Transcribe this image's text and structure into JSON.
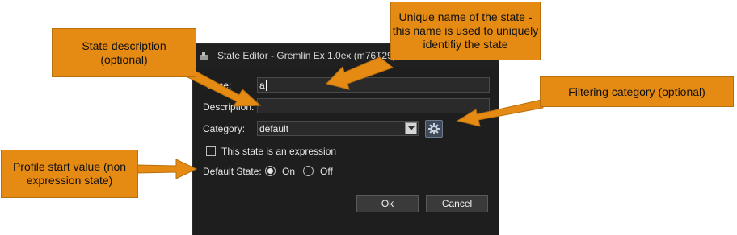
{
  "dialog": {
    "title": "State Editor - Gremlin Ex 1.0ex (m76T29)",
    "name_label": "Name:",
    "name_value": "a",
    "description_label": "Description:",
    "description_value": "",
    "category_label": "Category:",
    "category_value": "default",
    "expression_label": "This state is an expression",
    "expression_checked": false,
    "default_state_label": "Default State:",
    "default_on_label": "On",
    "default_off_label": "Off",
    "default_selected": "On",
    "ok_label": "Ok",
    "cancel_label": "Cancel"
  },
  "callouts": {
    "unique_name": "Unique name of the state - this name is used to uniquely identifiy the state",
    "state_description": "State description (optional)",
    "filtering_category": "Filtering category (optional)",
    "profile_start": "Profile start value (non expression state)"
  },
  "colors": {
    "callout_fill": "#e58a13",
    "dialog_bg": "#1e1e1e"
  },
  "icons": {
    "title_icon": "window-app-icon",
    "settings_icon": "gear-icon",
    "dropdown_icon": "chevron-down-icon"
  }
}
